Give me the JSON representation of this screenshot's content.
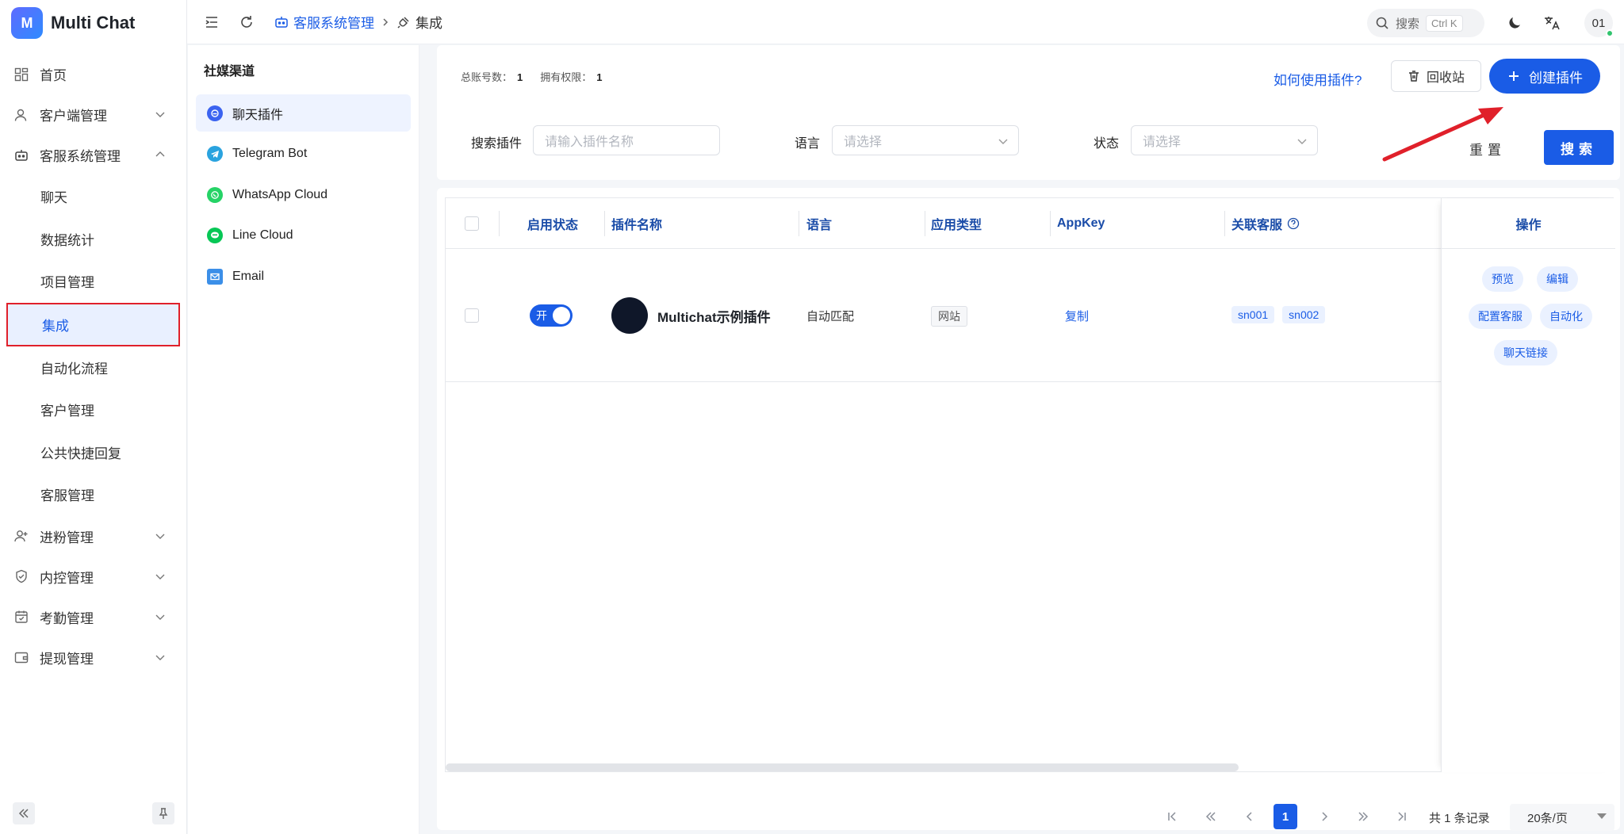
{
  "brand": {
    "name": "Multi Chat",
    "logo_letter": "M"
  },
  "sidebar": {
    "items": [
      {
        "label": "首页",
        "icon": "dashboard-icon"
      },
      {
        "label": "客户端管理",
        "icon": "user-icon",
        "expandable": true
      },
      {
        "label": "客服系统管理",
        "icon": "robot-icon",
        "expandable": true,
        "expanded": true
      }
    ],
    "sub_items": [
      "聊天",
      "数据统计",
      "项目管理",
      "集成",
      "自动化流程",
      "客户管理",
      "公共快捷回复",
      "客服管理"
    ],
    "active_sub": "集成",
    "items_after": [
      {
        "label": "进粉管理",
        "icon": "user-plus-icon"
      },
      {
        "label": "内控管理",
        "icon": "shield-icon"
      },
      {
        "label": "考勤管理",
        "icon": "calendar-icon"
      },
      {
        "label": "提现管理",
        "icon": "wallet-icon"
      }
    ]
  },
  "header": {
    "breadcrumb_parent": "客服系统管理",
    "breadcrumb_current": "集成",
    "search_label": "搜索",
    "search_shortcut": "Ctrl K",
    "avatar_text": "01"
  },
  "channels": {
    "title": "社媒渠道",
    "items": [
      {
        "label": "聊天插件",
        "color": "#3b63f0"
      },
      {
        "label": "Telegram Bot",
        "color": "#2aa3df"
      },
      {
        "label": "WhatsApp Cloud",
        "color": "#25d366"
      },
      {
        "label": "Line Cloud",
        "color": "#06c755"
      },
      {
        "label": "Email",
        "color": "#3b8fe8"
      }
    ],
    "active": "聊天插件"
  },
  "toolbar": {
    "total_accounts_label": "总账号数：",
    "total_accounts": "1",
    "permissions_label": "拥有权限：",
    "permissions": "1",
    "howto_link": "如何使用插件?",
    "recycle_label": "回收站",
    "create_label": "创建插件"
  },
  "filters": {
    "search_label": "搜索插件",
    "search_placeholder": "请输入插件名称",
    "language_label": "语言",
    "language_placeholder": "请选择",
    "status_label": "状态",
    "status_placeholder": "请选择",
    "reset_label": "重置",
    "search_button": "搜索"
  },
  "table": {
    "columns": [
      "启用状态",
      "插件名称",
      "语言",
      "应用类型",
      "AppKey",
      "关联客服",
      "操作"
    ],
    "rows": [
      {
        "enabled": true,
        "toggle_text": "开",
        "name": "Multichat示例插件",
        "language": "自动匹配",
        "app_type": "网站",
        "appkey_action": "复制",
        "agents": [
          "sn001",
          "sn002"
        ],
        "actions": [
          "预览",
          "编辑",
          "配置客服",
          "自动化",
          "聊天链接"
        ]
      }
    ]
  },
  "pagination": {
    "current_page": "1",
    "total_text": "共 1 条记录",
    "page_size": "20条/页"
  },
  "colors": {
    "primary": "#1a5ce6",
    "annotation": "#e0202a"
  }
}
